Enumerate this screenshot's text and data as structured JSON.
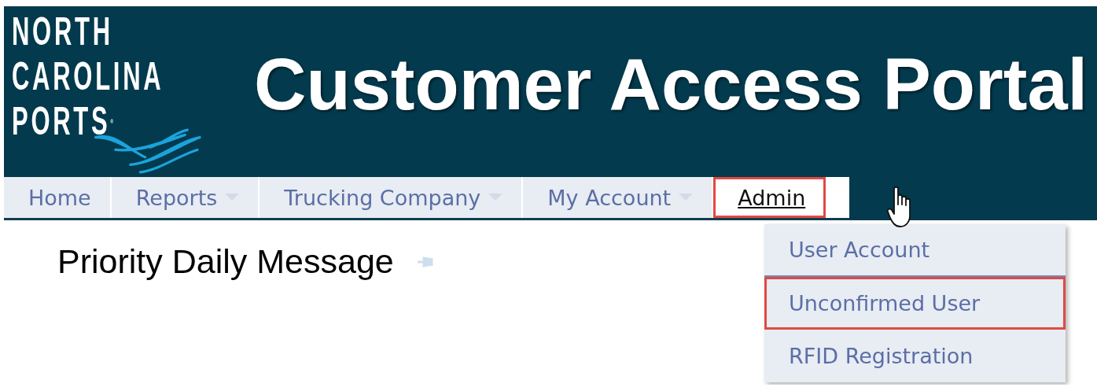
{
  "logo": {
    "lines": [
      "NORTH",
      "CAROLINA",
      "PORTS"
    ],
    "mark": "®"
  },
  "header": {
    "title": "Customer Access Portal"
  },
  "nav": [
    {
      "label": "Home",
      "has_dropdown": false,
      "selected": false,
      "highlighted": false
    },
    {
      "label": "Reports",
      "has_dropdown": true,
      "selected": false,
      "highlighted": false
    },
    {
      "label": "Trucking Company",
      "has_dropdown": true,
      "selected": false,
      "highlighted": false
    },
    {
      "label": "My Account",
      "has_dropdown": true,
      "selected": false,
      "highlighted": false
    },
    {
      "label": "Admin",
      "has_dropdown": false,
      "selected": true,
      "highlighted": true
    }
  ],
  "dropdown": [
    {
      "label": "User Account",
      "highlighted": false
    },
    {
      "label": "Unconfirmed User",
      "highlighted": true
    },
    {
      "label": "RFID Registration",
      "highlighted": false
    }
  ],
  "content": {
    "heading": "Priority Daily Message"
  }
}
